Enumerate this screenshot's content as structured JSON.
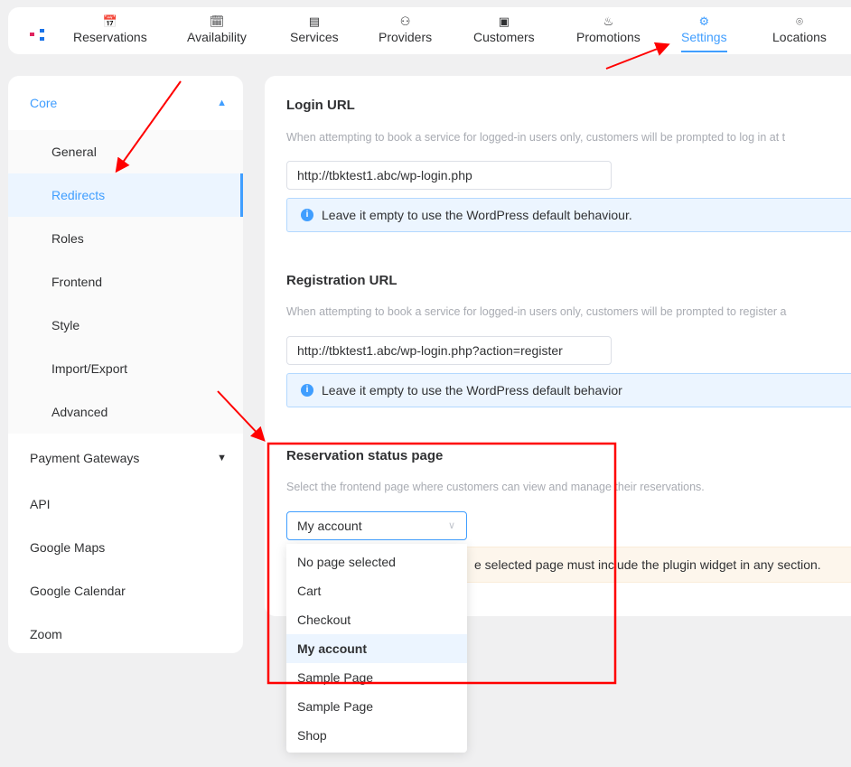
{
  "nav": {
    "items": [
      {
        "label": "Reservations",
        "icon": "calendar-ev-icon"
      },
      {
        "label": "Availability",
        "icon": "calendar-icon"
      },
      {
        "label": "Services",
        "icon": "document-icon"
      },
      {
        "label": "Providers",
        "icon": "users-icon"
      },
      {
        "label": "Customers",
        "icon": "contact-card-icon"
      },
      {
        "label": "Promotions",
        "icon": "flame-icon"
      },
      {
        "label": "Settings",
        "icon": "gear-icon",
        "active": true
      },
      {
        "label": "Locations",
        "icon": "map-pin-icon"
      }
    ],
    "accent": "#409eff"
  },
  "sidebar": {
    "core": "Core",
    "core_items": [
      "General",
      "Redirects",
      "Roles",
      "Frontend",
      "Style",
      "Import/Export",
      "Advanced"
    ],
    "active": "Redirects",
    "payment": "Payment Gateways",
    "items": [
      "API",
      "Google Maps",
      "Google Calendar",
      "Zoom"
    ]
  },
  "main": {
    "login": {
      "title": "Login URL",
      "desc": "When attempting to book a service for logged-in users only, customers will be prompted to log in at t",
      "value": "http://tbktest1.abc/wp-login.php",
      "info": "Leave it empty to use the WordPress default behaviour."
    },
    "registration": {
      "title": "Registration URL",
      "desc": "When attempting to book a service for logged-in users only, customers will be prompted to register a",
      "value": "http://tbktest1.abc/wp-login.php?action=register",
      "info": "Leave it empty to use the WordPress default behavior"
    },
    "status": {
      "title": "Reservation status page",
      "desc": "Select the frontend page where customers can view and manage their reservations.",
      "selected": "My account",
      "warning": "e selected page must include the plugin widget in any section.",
      "options": [
        "No page selected",
        "Cart",
        "Checkout",
        "My account",
        "Sample Page",
        "Sample Page",
        "Shop"
      ]
    }
  },
  "annotation_color": "#ff0000"
}
